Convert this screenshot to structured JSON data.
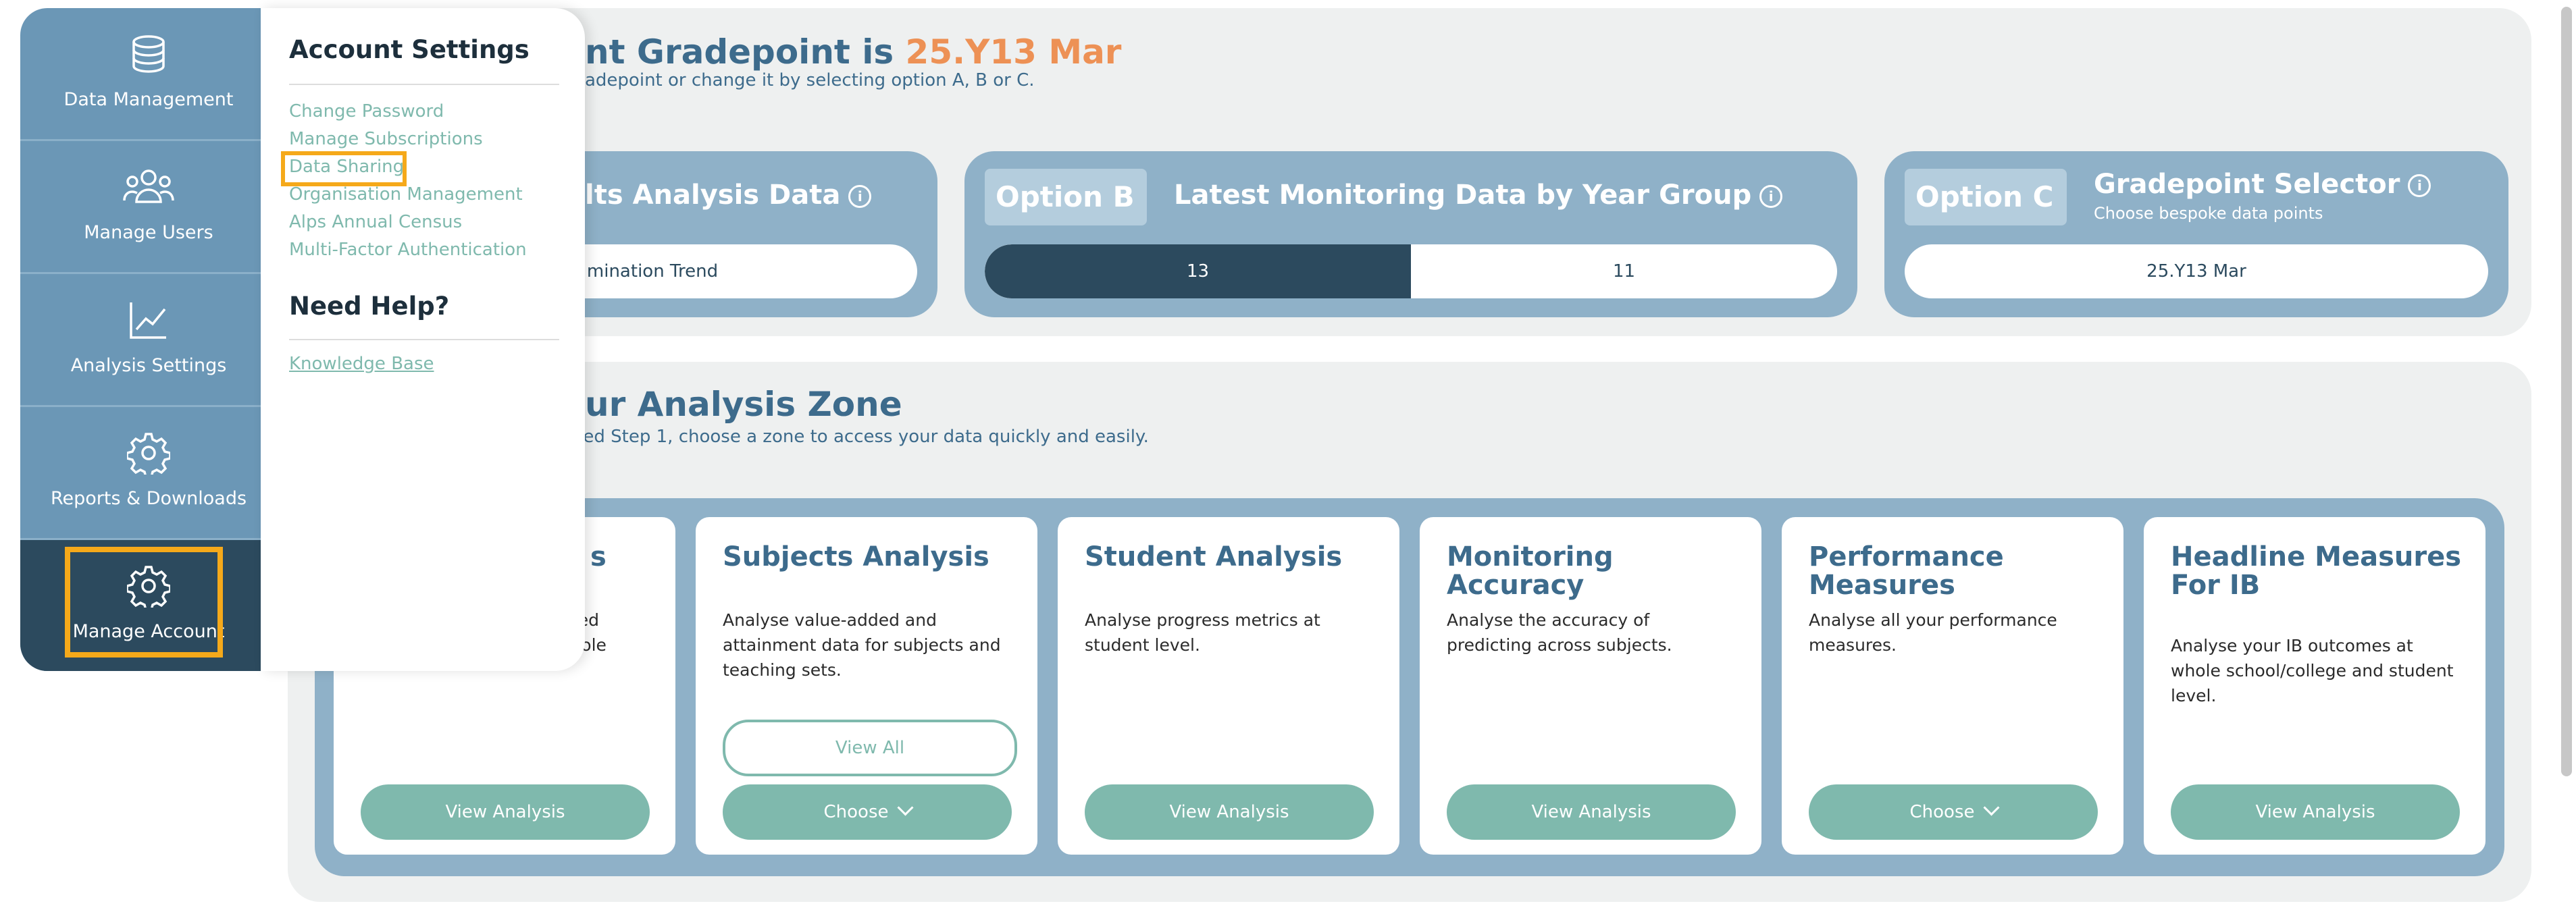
{
  "gradepoint": {
    "title_prefix": "nt Gradepoint is ",
    "title_value": "25.Y13 Mar",
    "subtitle": "adepoint or change it by selecting option A, B or C.",
    "option_a": {
      "title": "lts Analysis Data",
      "info": "i",
      "value": "mination Trend"
    },
    "option_b": {
      "badge": "Option B",
      "title": "Latest Monitoring Data by Year Group",
      "info": "i",
      "selected": "13",
      "other": "11"
    },
    "option_c": {
      "badge": "Option C",
      "title": "Gradepoint Selector",
      "info": "i",
      "subtitle": "Choose bespoke data points",
      "value": "25.Y13 Mar"
    }
  },
  "zone": {
    "title": "ur Analysis Zone",
    "subtitle": "leted Step 1, choose a zone to access your data quickly and easily.",
    "cards": [
      {
        "title": "s",
        "desc": "dded\nwhole",
        "button": "View Analysis"
      },
      {
        "title": "Subjects Analysis",
        "desc": "Analyse value-added and attainment data for subjects and teaching sets.",
        "secondary": "View All",
        "button": "Choose"
      },
      {
        "title": "Student Analysis",
        "desc": "Analyse progress metrics at student level.",
        "button": "View Analysis"
      },
      {
        "title": "Monitoring Accuracy",
        "desc": "Analyse the accuracy of predicting across subjects.",
        "button": "View Analysis"
      },
      {
        "title": "Performance Measures",
        "desc": "Analyse all your performance measures.",
        "button": "Choose"
      },
      {
        "title": "Headline Measures For IB",
        "desc": "Analyse your IB outcomes at whole school/college and student level.",
        "button": "View Analysis"
      }
    ]
  },
  "sidebar": {
    "items": [
      {
        "label": "Data Management",
        "icon": "database-icon"
      },
      {
        "label": "Manage Users",
        "icon": "users-icon"
      },
      {
        "label": "Analysis Settings",
        "icon": "chart-line-icon"
      },
      {
        "label": "Reports & Downloads",
        "icon": "gear-icon"
      },
      {
        "label": "Manage Account",
        "icon": "gear-icon"
      }
    ]
  },
  "flyout": {
    "heading": "Account Settings",
    "links": [
      "Change Password",
      "Manage Subscriptions",
      "Data Sharing",
      "Organisation Management",
      "Alps Annual Census",
      "Multi-Factor Authentication"
    ],
    "help_heading": "Need Help?",
    "help_link": "Knowledge Base"
  },
  "colors": {
    "accent": "#ed9155",
    "teal": "#7fb9ad",
    "sidebar": "#6b97b6",
    "sidebar_active": "#2c4a5e",
    "highlight": "#f5a91a"
  }
}
